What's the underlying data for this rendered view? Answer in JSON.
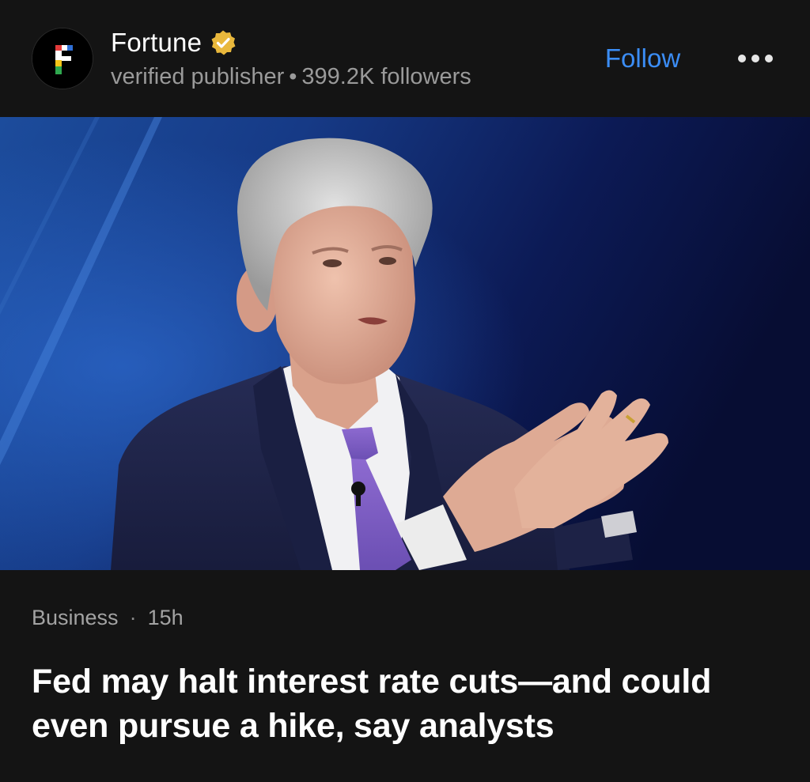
{
  "publisher": {
    "name": "Fortune",
    "logo_letter": "F",
    "subtitle": "verified publisher",
    "separator": "•",
    "followers": "399.2K followers",
    "follow_label": "Follow",
    "more_icon": "more-dots-icon",
    "verified_icon": "verified-badge-icon"
  },
  "article": {
    "category": "Business",
    "separator": "·",
    "age": "15h",
    "headline": "Fed may halt interest rate cuts—and could even pursue a hike, say analysts",
    "image_icon": "article-photo"
  },
  "colors": {
    "background": "#141414",
    "accent": "#3b8df5",
    "badge": "#e9b83c",
    "muted_text": "#9a9a9a"
  }
}
